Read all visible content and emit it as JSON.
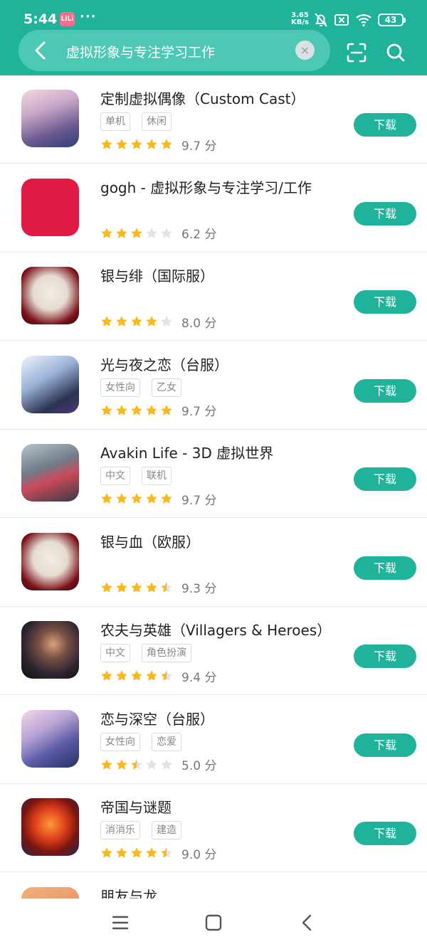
{
  "status_bar": {
    "time": "5:44",
    "badge_text": "LiLi",
    "dots": "···",
    "net_speed_value": "3.65",
    "net_speed_unit": "KB/s",
    "battery": "43"
  },
  "search": {
    "query": "虚拟形象与专注学习工作",
    "clear_label": "×"
  },
  "colors": {
    "accent": "#1fb39b",
    "star_full": "#fbb81a",
    "star_empty": "#e3e3e3"
  },
  "apps": [
    {
      "name": "定制虚拟偶像（Custom Cast）",
      "tags": [
        "单机",
        "休闲"
      ],
      "rating": 5,
      "score": "9.7 分",
      "download_label": "下载"
    },
    {
      "name": "gogh - 虚拟形象与专注学习/工作",
      "tags": [],
      "rating": 3,
      "score": "6.2 分",
      "download_label": "下载"
    },
    {
      "name": "银与绯（国际服）",
      "tags": [],
      "rating": 4,
      "score": "8.0 分",
      "download_label": "下载"
    },
    {
      "name": "光与夜之恋（台服）",
      "tags": [
        "女性向",
        "乙女"
      ],
      "rating": 5,
      "score": "9.7 分",
      "download_label": "下载"
    },
    {
      "name": "Avakin Life - 3D 虚拟世界",
      "tags": [
        "中文",
        "联机"
      ],
      "rating": 5,
      "score": "9.7 分",
      "download_label": "下载"
    },
    {
      "name": "银与血（欧服）",
      "tags": [],
      "rating": 4.5,
      "score": "9.3 分",
      "download_label": "下载"
    },
    {
      "name": "农夫与英雄（Villagers & Heroes）",
      "tags": [
        "中文",
        "角色扮演"
      ],
      "rating": 4.5,
      "score": "9.4 分",
      "download_label": "下载"
    },
    {
      "name": "恋与深空（台服）",
      "tags": [
        "女性向",
        "恋爱"
      ],
      "rating": 2.5,
      "score": "5.0 分",
      "download_label": "下载"
    },
    {
      "name": "帝国与谜题",
      "tags": [
        "消消乐",
        "建造"
      ],
      "rating": 4.5,
      "score": "9.0 分",
      "download_label": "下载"
    },
    {
      "name": "朋友与龙",
      "tags": [],
      "rating": 0,
      "score": "",
      "download_label": ""
    }
  ],
  "icons": {
    "status": [
      "mute-bell-icon",
      "sim-blocked-icon",
      "wifi-icon",
      "battery-icon"
    ],
    "header": [
      "back-arrow-icon",
      "clear-icon",
      "scan-icon",
      "search-icon"
    ],
    "nav": [
      "menu-icon",
      "home-icon",
      "back-icon"
    ]
  }
}
